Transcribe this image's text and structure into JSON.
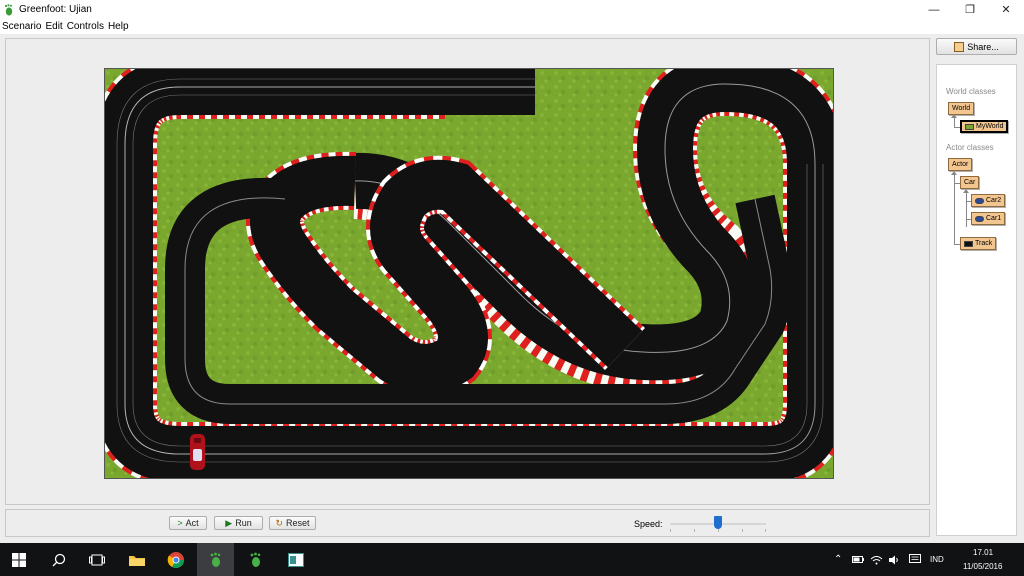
{
  "window": {
    "title": "Greenfoot: Ujian",
    "icon": "greenfoot-foot-icon"
  },
  "window_controls": {
    "minimize": "—",
    "restore": "❐",
    "close": "✕"
  },
  "menu": [
    "Scenario",
    "Edit",
    "Controls",
    "Help"
  ],
  "share": {
    "label": "Share..."
  },
  "classes": {
    "world_label": "World classes",
    "actor_label": "Actor classes",
    "world": "World",
    "my_world": "MyWorld",
    "actor": "Actor",
    "car": "Car",
    "car2": "Car2",
    "car1": "Car1",
    "track": "Track"
  },
  "controls": {
    "act": "Act",
    "run": "Run",
    "reset": "Reset",
    "speed_label": "Speed:",
    "speed_value": 0.5
  },
  "taskbar": {
    "apps": [
      "windows-start-icon",
      "search-icon",
      "task-view-icon",
      "file-explorer-icon",
      "chrome-icon",
      "greenfoot-icon",
      "greenfoot-icon",
      "app-icon"
    ],
    "language": "IND",
    "time": "17.01",
    "date": "11/05/2016"
  },
  "colors": {
    "grass": "#79a72f",
    "track": "#111111",
    "kerb_red": "#e0201e",
    "kerb_white": "#ffffff",
    "car": "#b0121b",
    "accent": "#1e6fd0"
  }
}
